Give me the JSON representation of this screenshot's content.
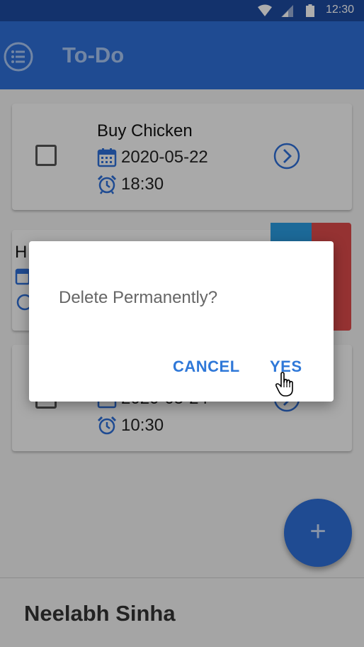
{
  "status_bar": {
    "time": "12:30"
  },
  "app_bar": {
    "title": "To-Do",
    "menu_icon": "list-menu-icon"
  },
  "todos": [
    {
      "title": "Buy Chicken",
      "date": "2020-05-22",
      "time": "18:30"
    },
    {
      "title": "H",
      "date": "",
      "time": ""
    },
    {
      "title": "",
      "date": "2020-05-24",
      "time": "10:30"
    }
  ],
  "fab": {
    "label": "+"
  },
  "bottom_bar": {
    "user_name": "Neelabh Sinha"
  },
  "dialog": {
    "message": "Delete Permanently?",
    "cancel_label": "CANCEL",
    "yes_label": "YES"
  },
  "colors": {
    "primary": "#2f6fd8",
    "primary_dark": "#1d4aa0",
    "accent_text": "#2f78d8",
    "swipe_edit": "#2a9be0",
    "swipe_delete": "#dc4a4a"
  }
}
